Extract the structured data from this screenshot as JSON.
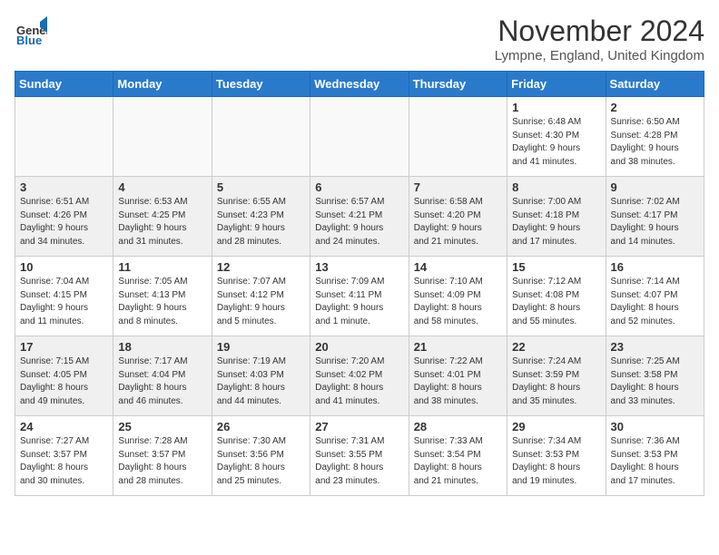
{
  "header": {
    "logo_general": "General",
    "logo_blue": "Blue",
    "month_title": "November 2024",
    "location": "Lympne, England, United Kingdom"
  },
  "days_of_week": [
    "Sunday",
    "Monday",
    "Tuesday",
    "Wednesday",
    "Thursday",
    "Friday",
    "Saturday"
  ],
  "weeks": [
    [
      {
        "day": "",
        "info": ""
      },
      {
        "day": "",
        "info": ""
      },
      {
        "day": "",
        "info": ""
      },
      {
        "day": "",
        "info": ""
      },
      {
        "day": "",
        "info": ""
      },
      {
        "day": "1",
        "info": "Sunrise: 6:48 AM\nSunset: 4:30 PM\nDaylight: 9 hours\nand 41 minutes."
      },
      {
        "day": "2",
        "info": "Sunrise: 6:50 AM\nSunset: 4:28 PM\nDaylight: 9 hours\nand 38 minutes."
      }
    ],
    [
      {
        "day": "3",
        "info": "Sunrise: 6:51 AM\nSunset: 4:26 PM\nDaylight: 9 hours\nand 34 minutes."
      },
      {
        "day": "4",
        "info": "Sunrise: 6:53 AM\nSunset: 4:25 PM\nDaylight: 9 hours\nand 31 minutes."
      },
      {
        "day": "5",
        "info": "Sunrise: 6:55 AM\nSunset: 4:23 PM\nDaylight: 9 hours\nand 28 minutes."
      },
      {
        "day": "6",
        "info": "Sunrise: 6:57 AM\nSunset: 4:21 PM\nDaylight: 9 hours\nand 24 minutes."
      },
      {
        "day": "7",
        "info": "Sunrise: 6:58 AM\nSunset: 4:20 PM\nDaylight: 9 hours\nand 21 minutes."
      },
      {
        "day": "8",
        "info": "Sunrise: 7:00 AM\nSunset: 4:18 PM\nDaylight: 9 hours\nand 17 minutes."
      },
      {
        "day": "9",
        "info": "Sunrise: 7:02 AM\nSunset: 4:17 PM\nDaylight: 9 hours\nand 14 minutes."
      }
    ],
    [
      {
        "day": "10",
        "info": "Sunrise: 7:04 AM\nSunset: 4:15 PM\nDaylight: 9 hours\nand 11 minutes."
      },
      {
        "day": "11",
        "info": "Sunrise: 7:05 AM\nSunset: 4:13 PM\nDaylight: 9 hours\nand 8 minutes."
      },
      {
        "day": "12",
        "info": "Sunrise: 7:07 AM\nSunset: 4:12 PM\nDaylight: 9 hours\nand 5 minutes."
      },
      {
        "day": "13",
        "info": "Sunrise: 7:09 AM\nSunset: 4:11 PM\nDaylight: 9 hours\nand 1 minute."
      },
      {
        "day": "14",
        "info": "Sunrise: 7:10 AM\nSunset: 4:09 PM\nDaylight: 8 hours\nand 58 minutes."
      },
      {
        "day": "15",
        "info": "Sunrise: 7:12 AM\nSunset: 4:08 PM\nDaylight: 8 hours\nand 55 minutes."
      },
      {
        "day": "16",
        "info": "Sunrise: 7:14 AM\nSunset: 4:07 PM\nDaylight: 8 hours\nand 52 minutes."
      }
    ],
    [
      {
        "day": "17",
        "info": "Sunrise: 7:15 AM\nSunset: 4:05 PM\nDaylight: 8 hours\nand 49 minutes."
      },
      {
        "day": "18",
        "info": "Sunrise: 7:17 AM\nSunset: 4:04 PM\nDaylight: 8 hours\nand 46 minutes."
      },
      {
        "day": "19",
        "info": "Sunrise: 7:19 AM\nSunset: 4:03 PM\nDaylight: 8 hours\nand 44 minutes."
      },
      {
        "day": "20",
        "info": "Sunrise: 7:20 AM\nSunset: 4:02 PM\nDaylight: 8 hours\nand 41 minutes."
      },
      {
        "day": "21",
        "info": "Sunrise: 7:22 AM\nSunset: 4:01 PM\nDaylight: 8 hours\nand 38 minutes."
      },
      {
        "day": "22",
        "info": "Sunrise: 7:24 AM\nSunset: 3:59 PM\nDaylight: 8 hours\nand 35 minutes."
      },
      {
        "day": "23",
        "info": "Sunrise: 7:25 AM\nSunset: 3:58 PM\nDaylight: 8 hours\nand 33 minutes."
      }
    ],
    [
      {
        "day": "24",
        "info": "Sunrise: 7:27 AM\nSunset: 3:57 PM\nDaylight: 8 hours\nand 30 minutes."
      },
      {
        "day": "25",
        "info": "Sunrise: 7:28 AM\nSunset: 3:57 PM\nDaylight: 8 hours\nand 28 minutes."
      },
      {
        "day": "26",
        "info": "Sunrise: 7:30 AM\nSunset: 3:56 PM\nDaylight: 8 hours\nand 25 minutes."
      },
      {
        "day": "27",
        "info": "Sunrise: 7:31 AM\nSunset: 3:55 PM\nDaylight: 8 hours\nand 23 minutes."
      },
      {
        "day": "28",
        "info": "Sunrise: 7:33 AM\nSunset: 3:54 PM\nDaylight: 8 hours\nand 21 minutes."
      },
      {
        "day": "29",
        "info": "Sunrise: 7:34 AM\nSunset: 3:53 PM\nDaylight: 8 hours\nand 19 minutes."
      },
      {
        "day": "30",
        "info": "Sunrise: 7:36 AM\nSunset: 3:53 PM\nDaylight: 8 hours\nand 17 minutes."
      }
    ]
  ]
}
